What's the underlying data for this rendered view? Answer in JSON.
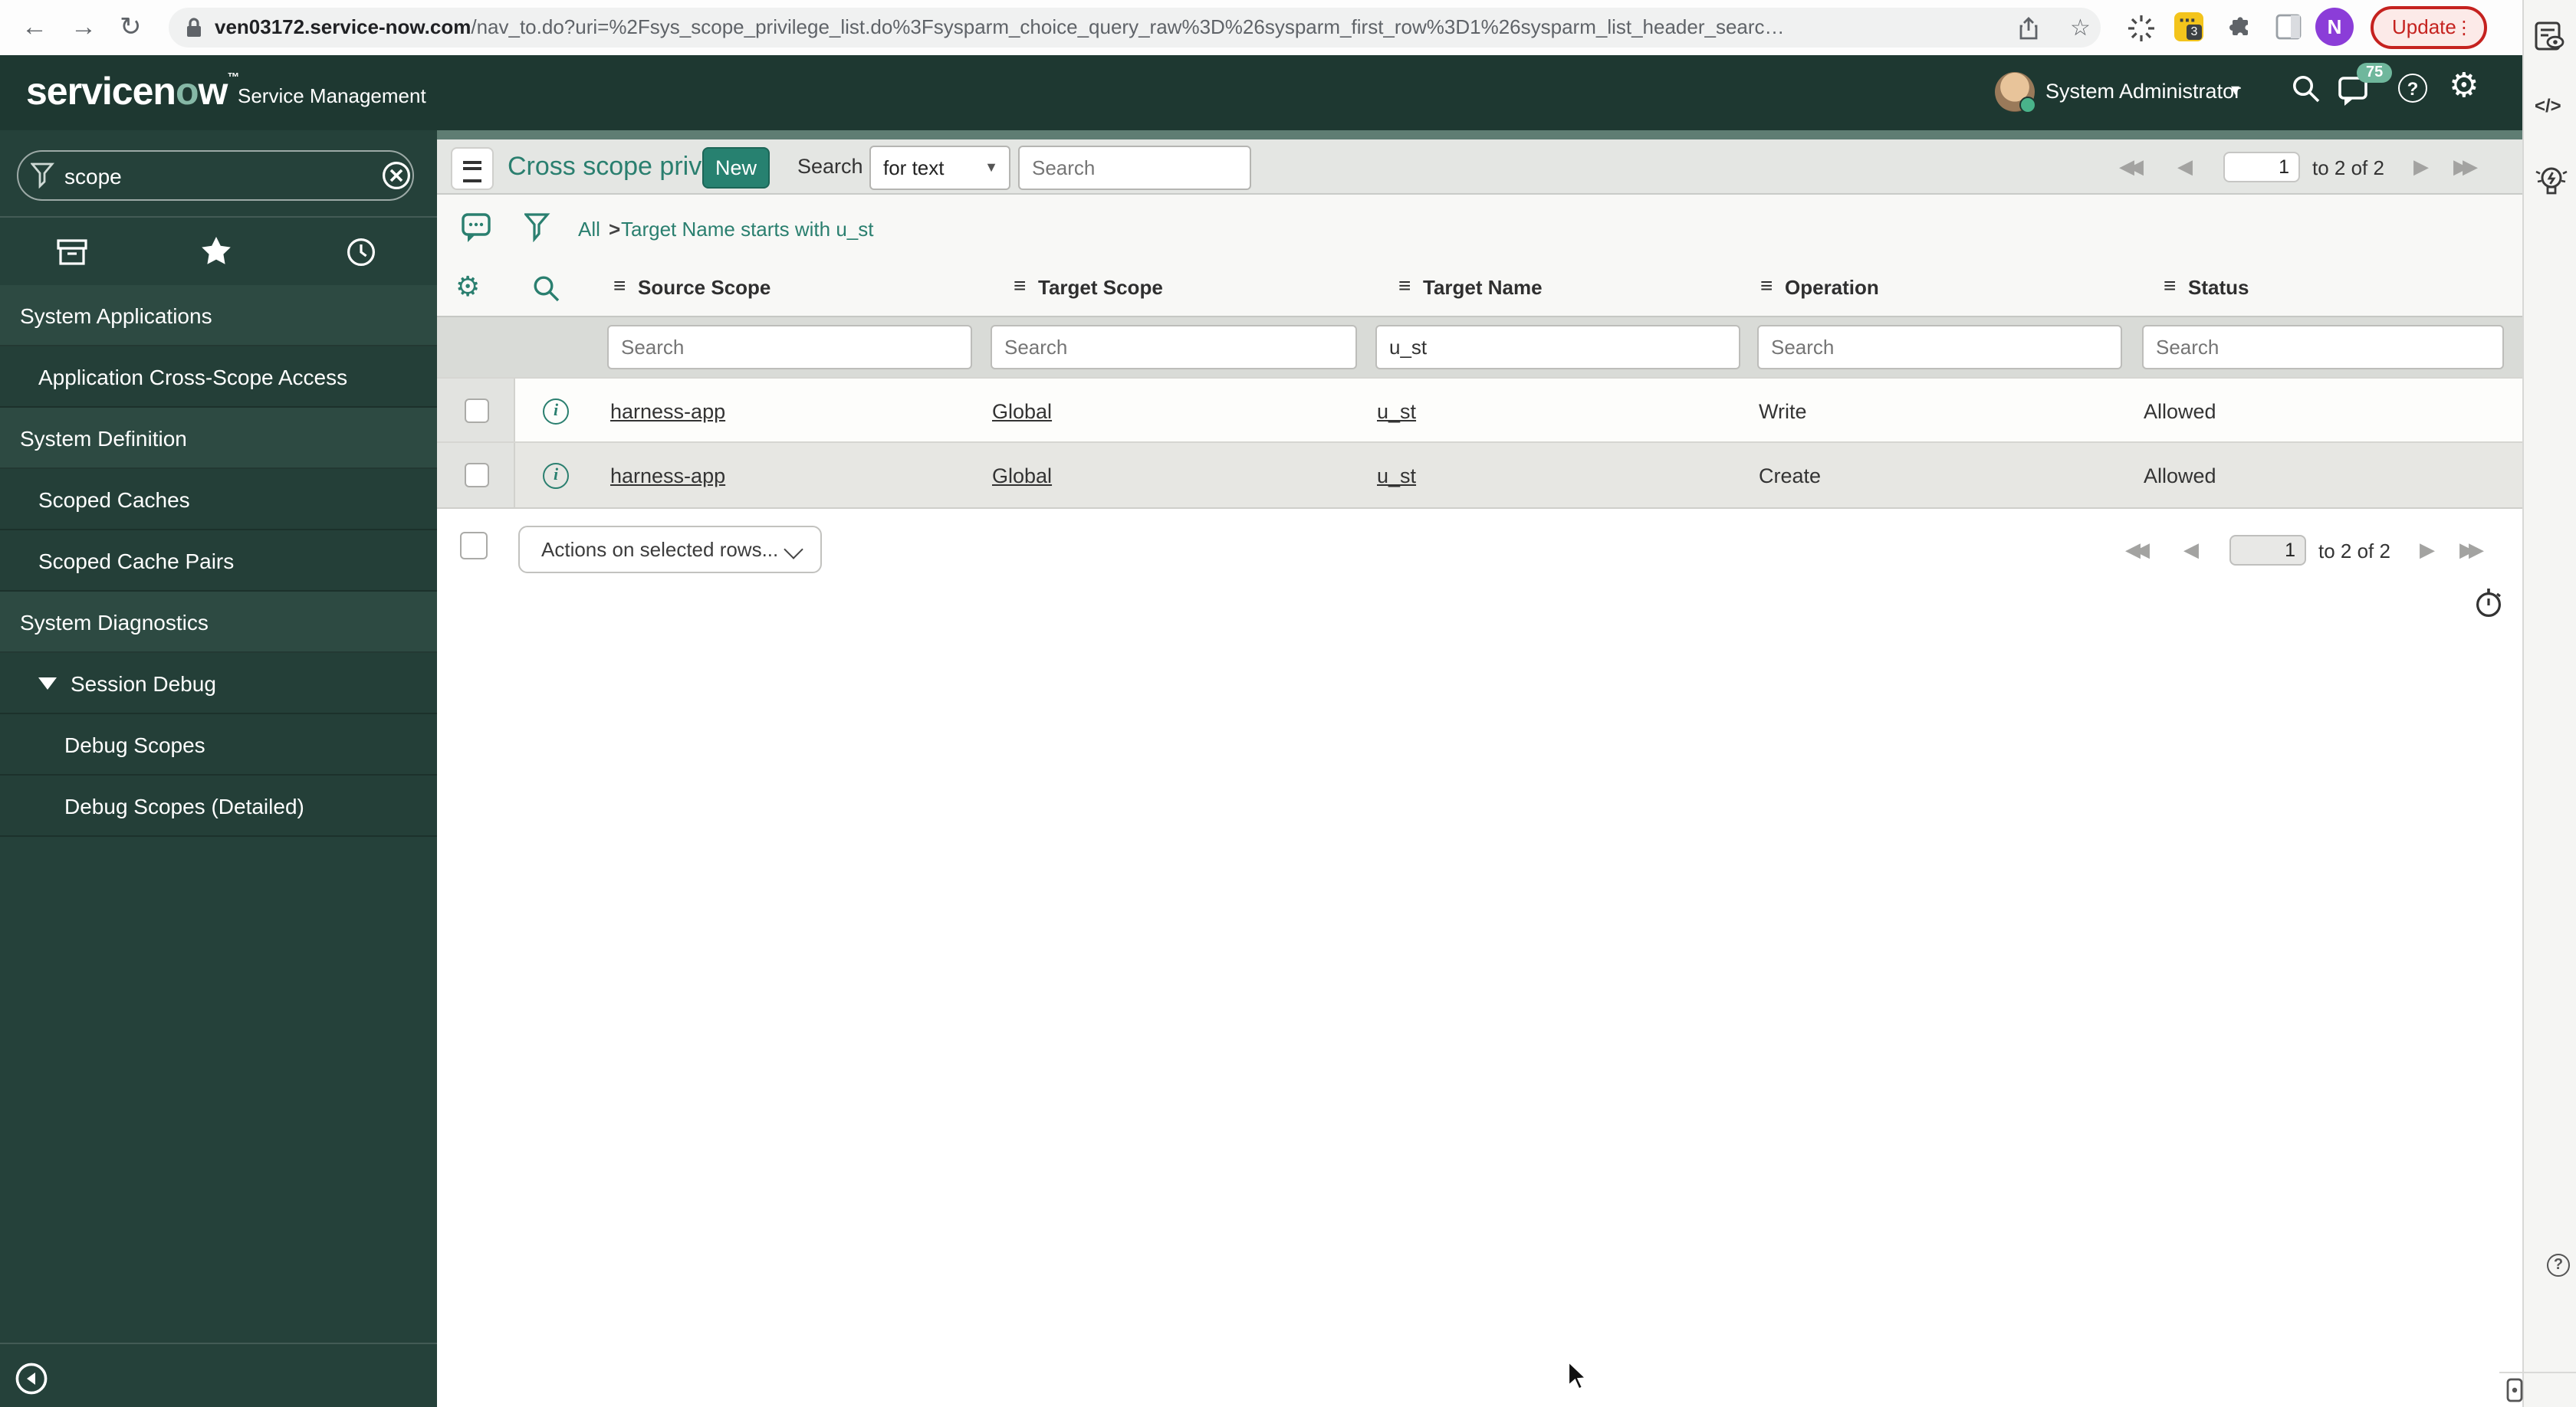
{
  "browser": {
    "url_domain": "ven03172.service-now.com",
    "url_path": "/nav_to.do?uri=%2Fsys_scope_privilege_list.do%3Fsysparm_choice_query_raw%3D%26sysparm_first_row%3D1%26sysparm_list_header_searc…",
    "update_label": "Update",
    "profile_initial": "N",
    "extension_badge": "3"
  },
  "app_header": {
    "logo_part1": "servicen",
    "logo_o": "o",
    "logo_part2": "w",
    "logo_tm": "™",
    "product": "Service Management",
    "user_name": "System Administrator",
    "notification_count": "75"
  },
  "sidebar": {
    "filter_value": "scope",
    "nav": [
      {
        "label": "System Applications",
        "type": "section"
      },
      {
        "label": "Application Cross-Scope Access",
        "type": "module"
      },
      {
        "label": "System Definition",
        "type": "section"
      },
      {
        "label": "Scoped Caches",
        "type": "module"
      },
      {
        "label": "Scoped Cache Pairs",
        "type": "module"
      },
      {
        "label": "System Diagnostics",
        "type": "section"
      },
      {
        "label": "Session Debug",
        "type": "module-expanded"
      },
      {
        "label": "Debug Scopes",
        "type": "submodule"
      },
      {
        "label": "Debug Scopes (Detailed)",
        "type": "submodule"
      }
    ]
  },
  "list": {
    "title": "Cross scope privileges",
    "new_label": "New",
    "search_label": "Search",
    "search_mode": "for text",
    "search_placeholder": "Search",
    "breadcrumb_all": "All",
    "breadcrumb_sep": ">",
    "breadcrumb_filter": "Target Name starts with u_st",
    "page_value": "1",
    "page_range": "to 2 of 2",
    "columns": [
      "Source Scope",
      "Target Scope",
      "Target Name",
      "Operation",
      "Status"
    ],
    "filter_target_name": "u_st",
    "rows": [
      {
        "source_scope": "harness-app",
        "target_scope": "Global",
        "target_name": "u_st",
        "operation": "Write",
        "status": "Allowed"
      },
      {
        "source_scope": "harness-app",
        "target_scope": "Global",
        "target_name": "u_st",
        "operation": "Create",
        "status": "Allowed"
      }
    ],
    "actions_placeholder": "Actions on selected rows..."
  },
  "icons": {
    "back": "←",
    "forward": "→",
    "reload": "↻",
    "star": "☆",
    "ellipsis_dots": "⋯",
    "kebab": "⋮",
    "menu_lines": "≡",
    "dropdown_triangle": "▼",
    "user_caret": "▾",
    "prev_double": "◀◀",
    "prev": "◀",
    "next": "▶",
    "next_double": "▶▶",
    "code": "</>",
    "question": "?",
    "info": "i",
    "gear": "⚙"
  },
  "colors": {
    "brand_teal": "#2a7f6f",
    "header_bg": "#1e3831",
    "sidebar_bg": "#25413a",
    "accent_strip": "#5f7d73",
    "badge_green": "#6fb79c",
    "update_red": "#c5221f",
    "extension_yellow": "#f3c41c",
    "profile_purple": "#8b3dd8"
  }
}
